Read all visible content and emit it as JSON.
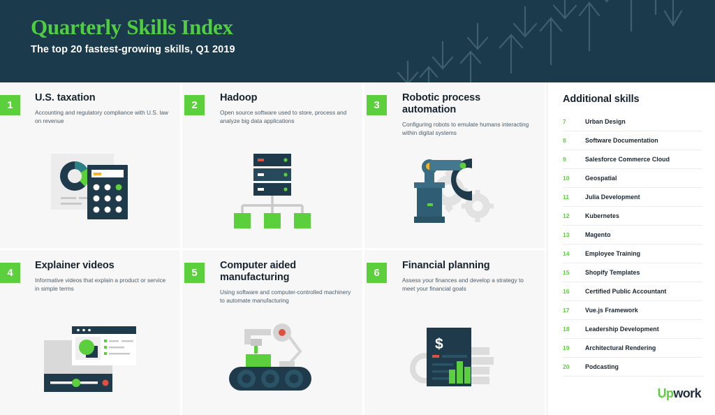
{
  "header": {
    "title": "Quarterly Skills Index",
    "subtitle": "The top 20 fastest-growing skills, Q1 2019",
    "bg_color": "#1b3a4b",
    "title_color": "#4fce3f",
    "decoration": "arrow-pattern"
  },
  "theme": {
    "green": "#5ccf3c",
    "navy": "#1f3a4b",
    "card_bg": "#f7f7f7",
    "text_dark": "#17242f",
    "text_muted": "#4a5b69"
  },
  "cards": [
    {
      "number": "1",
      "title": "U.S. taxation",
      "description": "Accounting and regulatory compliance with U.S. law on revenue",
      "art": "donut-chart-and-calculator-icon"
    },
    {
      "number": "2",
      "title": "Hadoop",
      "description": "Open source software used to store, process and analyze big data applications",
      "art": "server-rack-network-icon"
    },
    {
      "number": "3",
      "title": "Robotic process automation",
      "description": "Configuring robots to emulate humans interacting within digital systems",
      "art": "robotic-arm-and-gears-icon"
    },
    {
      "number": "4",
      "title": "Explainer videos",
      "description": "Informative videos that explain a product or service in simple terms",
      "art": "video-player-window-icon"
    },
    {
      "number": "5",
      "title": "Computer aided manufacturing",
      "description": "Using software and computer-controlled machinery to automate manufacturing",
      "art": "tracked-robot-arm-icon"
    },
    {
      "number": "6",
      "title": "Financial planning",
      "description": "Assess your finances and develop a strategy to meet your financial goals",
      "art": "financial-report-document-icon"
    }
  ],
  "sidebar": {
    "title": "Additional skills",
    "items": [
      {
        "number": "7",
        "label": "Urban Design"
      },
      {
        "number": "8",
        "label": "Software Documentation"
      },
      {
        "number": "9",
        "label": "Salesforce Commerce Cloud"
      },
      {
        "number": "10",
        "label": "Geospatial"
      },
      {
        "number": "11",
        "label": "Julia Development"
      },
      {
        "number": "12",
        "label": "Kubernetes"
      },
      {
        "number": "13",
        "label": "Magento"
      },
      {
        "number": "14",
        "label": "Employee Training"
      },
      {
        "number": "15",
        "label": "Shopify Templates"
      },
      {
        "number": "16",
        "label": "Certified Public Accountant"
      },
      {
        "number": "17",
        "label": "Vue.js Framework"
      },
      {
        "number": "18",
        "label": "Leadership Development"
      },
      {
        "number": "19",
        "label": "Architectural Rendering"
      },
      {
        "number": "20",
        "label": "Podcasting"
      }
    ]
  },
  "logo": {
    "part1": "Up",
    "part2": "work"
  }
}
